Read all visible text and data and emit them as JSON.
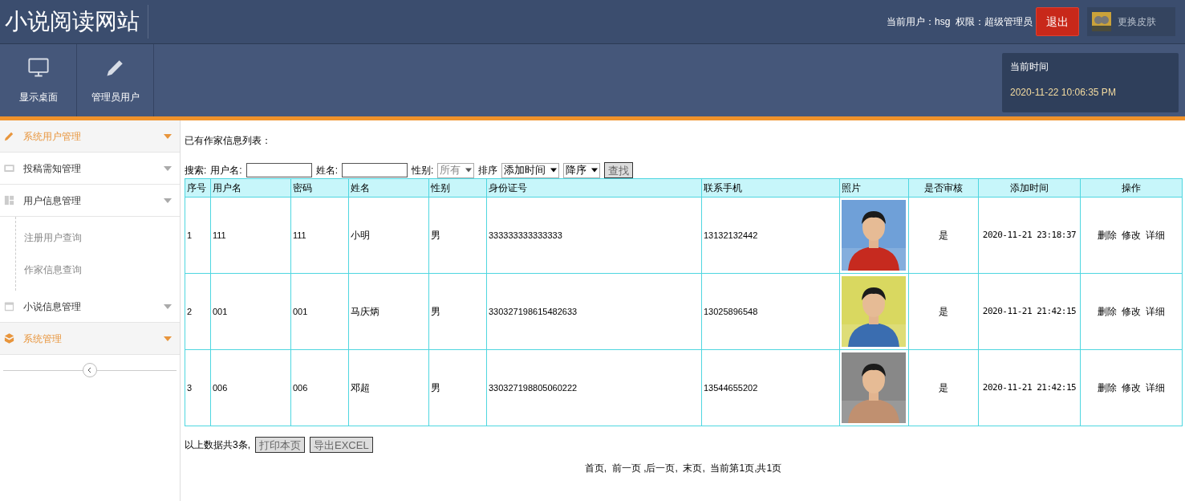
{
  "header": {
    "title": "小说阅读网站",
    "user_info": "当前用户：hsg  权限：超级管理员",
    "logout": "退出",
    "skin": "更换皮肤"
  },
  "toolbar": [
    {
      "label": "显示桌面"
    },
    {
      "label": "管理员用户"
    }
  ],
  "clock": {
    "label": "当前时间",
    "time": "2020-11-22 10:06:35 PM"
  },
  "sidebar": [
    {
      "label": "系统用户管理",
      "active": true
    },
    {
      "label": "投稿需知管理",
      "active": false
    },
    {
      "label": "用户信息管理",
      "active": false,
      "children": [
        {
          "label": "注册用户查询"
        },
        {
          "label": "作家信息查询"
        }
      ]
    },
    {
      "label": "小说信息管理",
      "active": false
    },
    {
      "label": "系统管理",
      "active": true
    }
  ],
  "content": {
    "heading": "已有作家信息列表：",
    "search": {
      "label": "搜索:",
      "username_label": "用户名:",
      "name_label": "姓名:",
      "gender_label": "性别:",
      "gender_value": "所有",
      "sort_label": "排序",
      "sort_field": "添加时间",
      "sort_order": "降序",
      "button": "查找"
    },
    "table": {
      "columns": [
        "序号",
        "用户名",
        "密码",
        "姓名",
        "性别",
        "身份证号",
        "联系手机",
        "照片",
        "是否审核",
        "添加时间",
        "操作"
      ],
      "rows": [
        {
          "cells": [
            "1",
            "111",
            "111",
            "小明",
            "男",
            "333333333333333",
            "13132132442"
          ],
          "approved": "是",
          "added": "2020-11-21 23:18:37",
          "actions": [
            "删除",
            "修改",
            "详细"
          ]
        },
        {
          "cells": [
            "2",
            "001",
            "001",
            "马庆炳",
            "男",
            "330327198615482633",
            "13025896548"
          ],
          "approved": "是",
          "added": "2020-11-21 21:42:15",
          "actions": [
            "删除",
            "修改",
            "详细"
          ]
        },
        {
          "cells": [
            "3",
            "006",
            "006",
            "邓超",
            "男",
            "330327198805060222",
            "13544655202"
          ],
          "approved": "是",
          "added": "2020-11-21 21:42:15",
          "actions": [
            "删除",
            "修改",
            "详细"
          ]
        }
      ]
    },
    "summary": "以上数据共3条,",
    "print_button": "打印本页",
    "export_button": "导出EXCEL",
    "pagination": "首页,  前一页 ,后一页,  末页,  当前第1页,共1页"
  }
}
